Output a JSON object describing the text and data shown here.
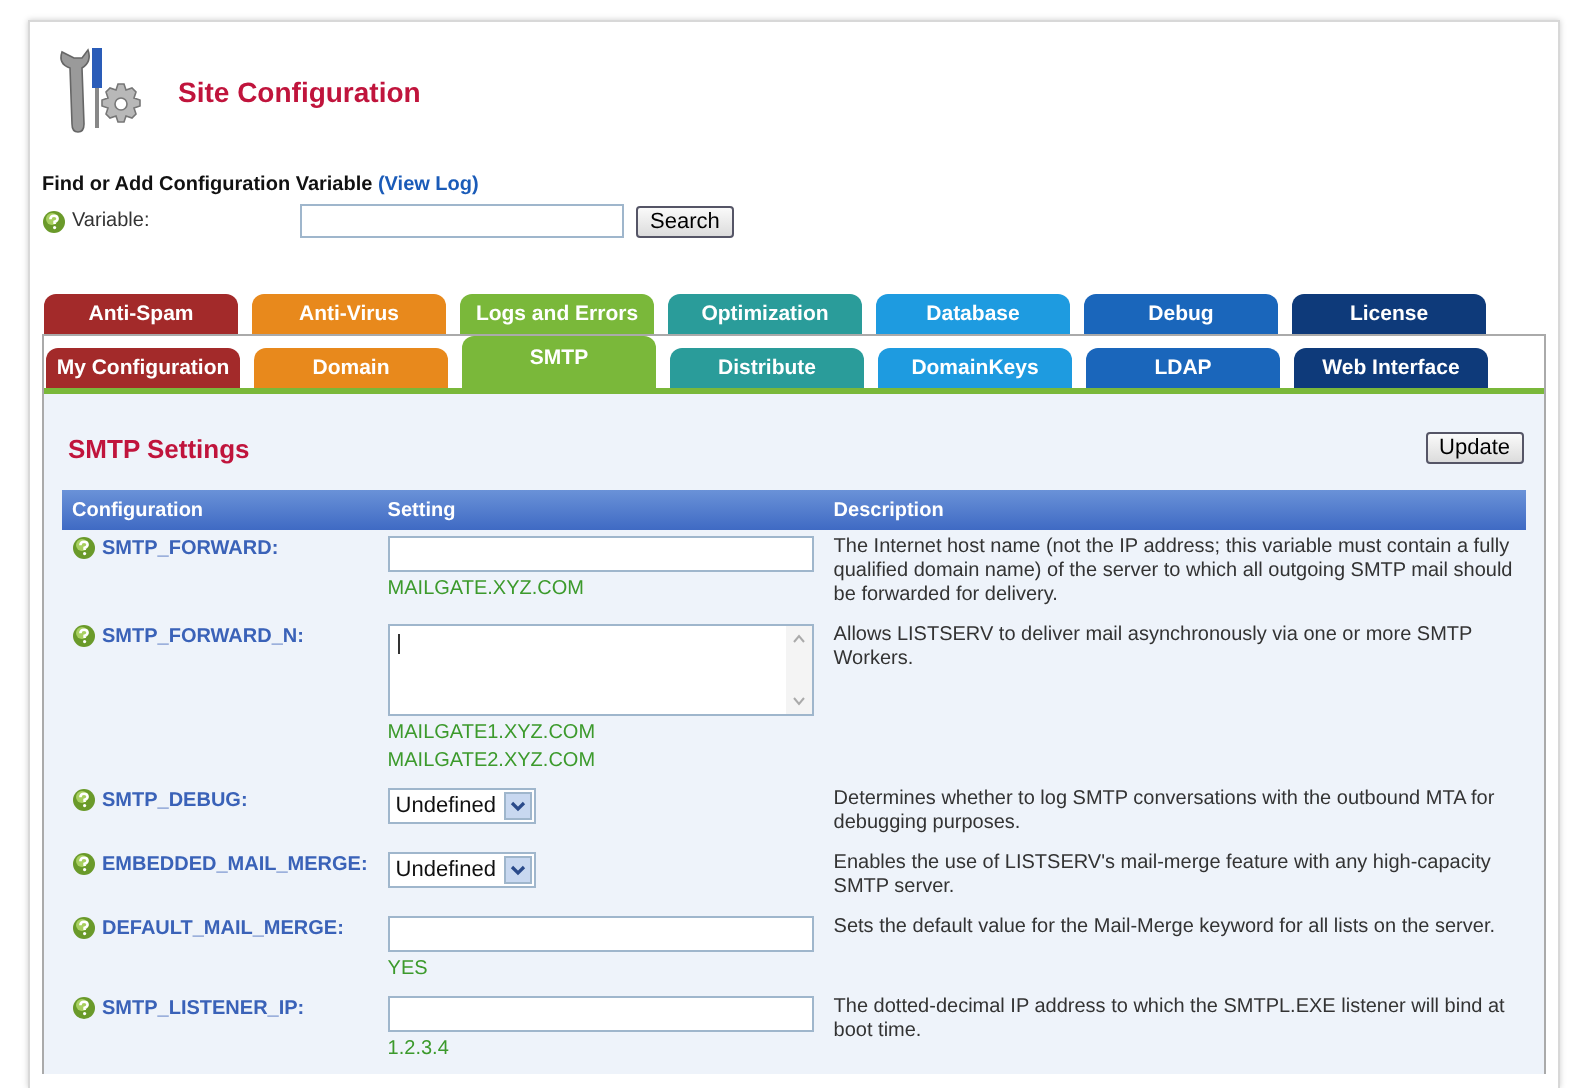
{
  "header": {
    "title": "Site Configuration"
  },
  "search": {
    "heading": "Find or Add Configuration Variable",
    "link": "(View Log)",
    "field_label": "Variable:",
    "button": "Search"
  },
  "tabs_row_1": [
    {
      "label": "Anti-Spam",
      "color": "#a32a2a",
      "selected": false
    },
    {
      "label": "Anti-Virus",
      "color": "#e8891c",
      "selected": false
    },
    {
      "label": "Logs and Errors",
      "color": "#7ab83a",
      "selected": false
    },
    {
      "label": "Optimization",
      "color": "#2a9c9a",
      "selected": false
    },
    {
      "label": "Database",
      "color": "#1e9be0",
      "selected": false
    },
    {
      "label": "Debug",
      "color": "#1a66bb",
      "selected": false
    },
    {
      "label": "License",
      "color": "#0e3a7a",
      "selected": false
    }
  ],
  "tabs_row_2": [
    {
      "label": "My Configuration",
      "color": "#a32a2a",
      "selected": false
    },
    {
      "label": "Domain",
      "color": "#e8891c",
      "selected": false
    },
    {
      "label": "SMTP",
      "color": "#7ab83a",
      "selected": true
    },
    {
      "label": "Distribute",
      "color": "#2a9c9a",
      "selected": false
    },
    {
      "label": "DomainKeys",
      "color": "#1e9be0",
      "selected": false
    },
    {
      "label": "LDAP",
      "color": "#1a66bb",
      "selected": false
    },
    {
      "label": "Web Interface",
      "color": "#0e3a7a",
      "selected": false
    }
  ],
  "section": {
    "title": "SMTP Settings",
    "button": "Update"
  },
  "table": {
    "columns": [
      "Configuration",
      "Setting",
      "Description"
    ],
    "rows": [
      {
        "name": "SMTP_FORWARD:",
        "kind": "text",
        "defaults": [
          "MAILGATE.XYZ.COM"
        ],
        "description": "The Internet host name (not the IP address; this variable must contain a fully qualified domain name) of the server to which all outgoing SMTP mail should be forwarded for delivery."
      },
      {
        "name": "SMTP_FORWARD_N:",
        "kind": "textarea",
        "defaults": [
          "MAILGATE1.XYZ.COM",
          "MAILGATE2.XYZ.COM"
        ],
        "description": "Allows LISTSERV to deliver mail asynchronously via one or more SMTP Workers."
      },
      {
        "name": "SMTP_DEBUG:",
        "kind": "select",
        "value": "Undefined",
        "description": "Determines whether to log SMTP conversations with the outbound MTA for debugging purposes."
      },
      {
        "name": "EMBEDDED_MAIL_MERGE:",
        "kind": "select",
        "value": "Undefined",
        "description": "Enables the use of LISTSERV's mail-merge feature with any high-capacity SMTP server."
      },
      {
        "name": "DEFAULT_MAIL_MERGE:",
        "kind": "text",
        "defaults": [
          "YES"
        ],
        "description": "Sets the default value for the Mail-Merge keyword for all lists on the server."
      },
      {
        "name": "SMTP_LISTENER_IP:",
        "kind": "text",
        "defaults": [
          "1.2.3.4"
        ],
        "description": "The dotted-decimal IP address to which the SMTPL.EXE listener will bind at boot time."
      }
    ]
  }
}
